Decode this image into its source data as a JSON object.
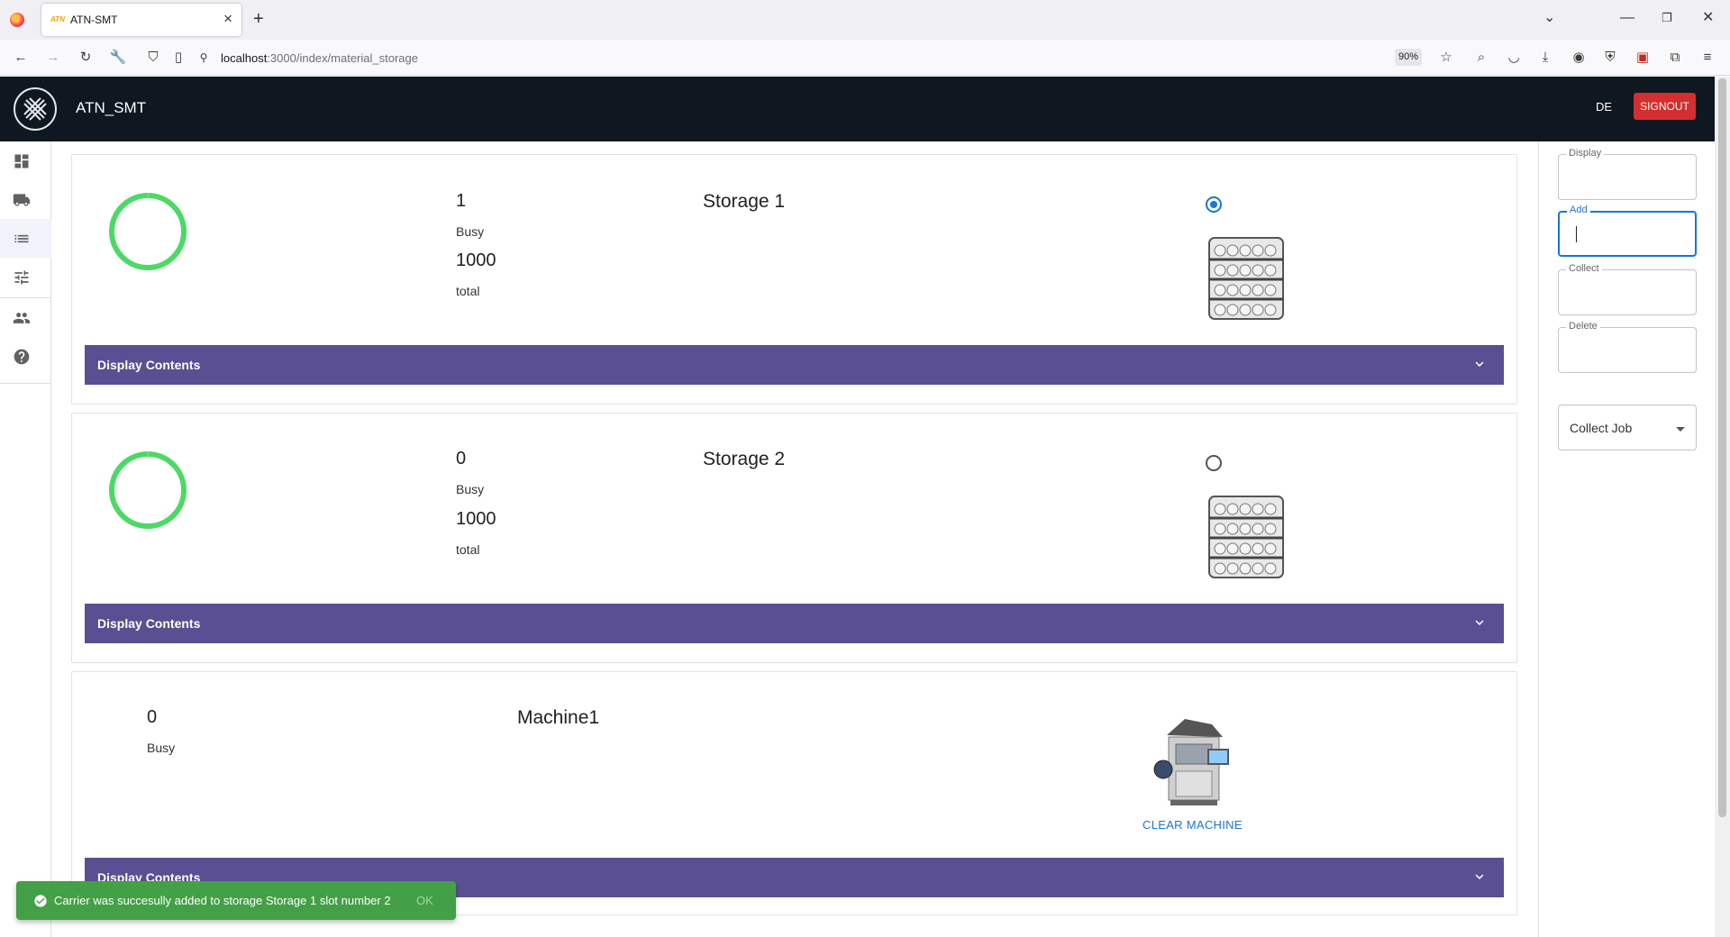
{
  "browser": {
    "tab_title": "ATN-SMT",
    "url_host": "localhost",
    "url_path": ":3000/index/material_storage",
    "zoom": "90%"
  },
  "app": {
    "title": "ATN_SMT",
    "lang_label": "DE",
    "signout_label": "SIGNOUT"
  },
  "nav": [
    "dashboard-icon",
    "truck-icon",
    "list-icon",
    "tune-icon",
    "people-icon",
    "help-icon"
  ],
  "storages": [
    {
      "name": "Storage 1",
      "busy": "1",
      "busy_label": "Busy",
      "total": "1000",
      "total_label": "total",
      "selected": true,
      "accordion_label": "Display Contents"
    },
    {
      "name": "Storage 2",
      "busy": "0",
      "busy_label": "Busy",
      "total": "1000",
      "total_label": "total",
      "selected": false,
      "accordion_label": "Display Contents"
    }
  ],
  "machine": {
    "name": "Machine1",
    "busy": "0",
    "busy_label": "Busy",
    "clear_label": "CLEAR MACHINE",
    "accordion_label": "Display Contents"
  },
  "sidepanel": {
    "fields": [
      {
        "label": "Display",
        "value": ""
      },
      {
        "label": "Add",
        "value": ""
      },
      {
        "label": "Collect",
        "value": ""
      },
      {
        "label": "Delete",
        "value": ""
      }
    ],
    "select_value": "Collect Job"
  },
  "snackbar": {
    "message": "Carrier was succesully added to storage Storage 1 slot number 2",
    "action": "OK"
  },
  "colors": {
    "appbar": "#0f1720",
    "accordion": "#5a4f92",
    "ring": "#4cd964",
    "signout": "#d32f2f",
    "snackbar": "#43a047",
    "accent": "#1976d2"
  }
}
